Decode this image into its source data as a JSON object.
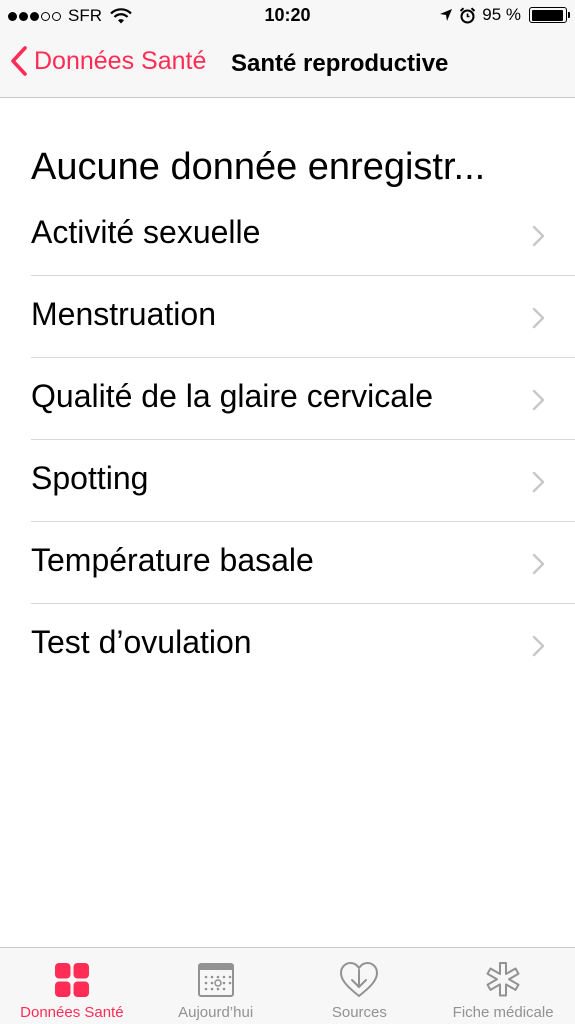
{
  "status_bar": {
    "carrier": "SFR",
    "time": "10:20",
    "battery_text": "95 %",
    "battery_level": 0.95
  },
  "nav": {
    "back_label": "Données Santé",
    "title": "Santé reproductive"
  },
  "section_header": "Aucune donnée enregistr...",
  "items": [
    {
      "label": "Activité sexuelle"
    },
    {
      "label": "Menstruation"
    },
    {
      "label": "Qualité de la glaire cervicale"
    },
    {
      "label": "Spotting"
    },
    {
      "label": "Température basale"
    },
    {
      "label": "Test d’ovulation"
    }
  ],
  "tabs": [
    {
      "label": "Données Santé",
      "icon": "health-data-icon",
      "active": true
    },
    {
      "label": "Aujourd’hui",
      "icon": "calendar-icon",
      "active": false
    },
    {
      "label": "Sources",
      "icon": "sources-heart-icon",
      "active": false
    },
    {
      "label": "Fiche médicale",
      "icon": "medical-id-icon",
      "active": false
    }
  ],
  "colors": {
    "accent": "#ff2d55",
    "inactive_tab": "#929292",
    "chevron": "#c7c7cc"
  }
}
